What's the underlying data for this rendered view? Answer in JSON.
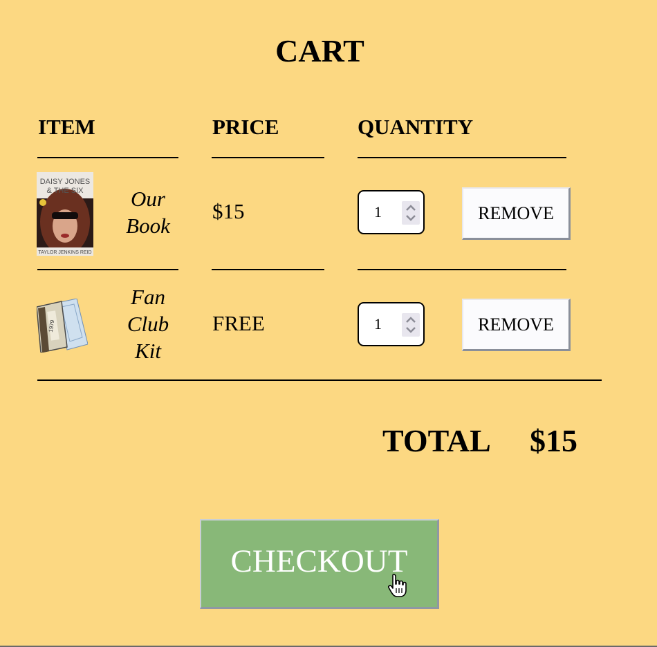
{
  "title": "CART",
  "columns": {
    "item": "ITEM",
    "price": "PRICE",
    "quantity": "QUANTITY"
  },
  "items": [
    {
      "name": "Our Book",
      "price": "$15",
      "quantity": "1",
      "remove_label": "REMOVE",
      "cover_text": {
        "top": "DAISY JONES",
        "middle": "& THE SIX",
        "bottom": "TAYLOR JENKINS REID"
      }
    },
    {
      "name": "Fan Club Kit",
      "price": "FREE",
      "quantity": "1",
      "remove_label": "REMOVE"
    }
  ],
  "total": {
    "label": "TOTAL",
    "value": "$15"
  },
  "checkout_label": "CHECKOUT",
  "colors": {
    "background": "#fcd882",
    "checkout": "#88b878"
  },
  "icons": [
    "spinner-up-icon",
    "spinner-down-icon",
    "hand-cursor-icon"
  ]
}
